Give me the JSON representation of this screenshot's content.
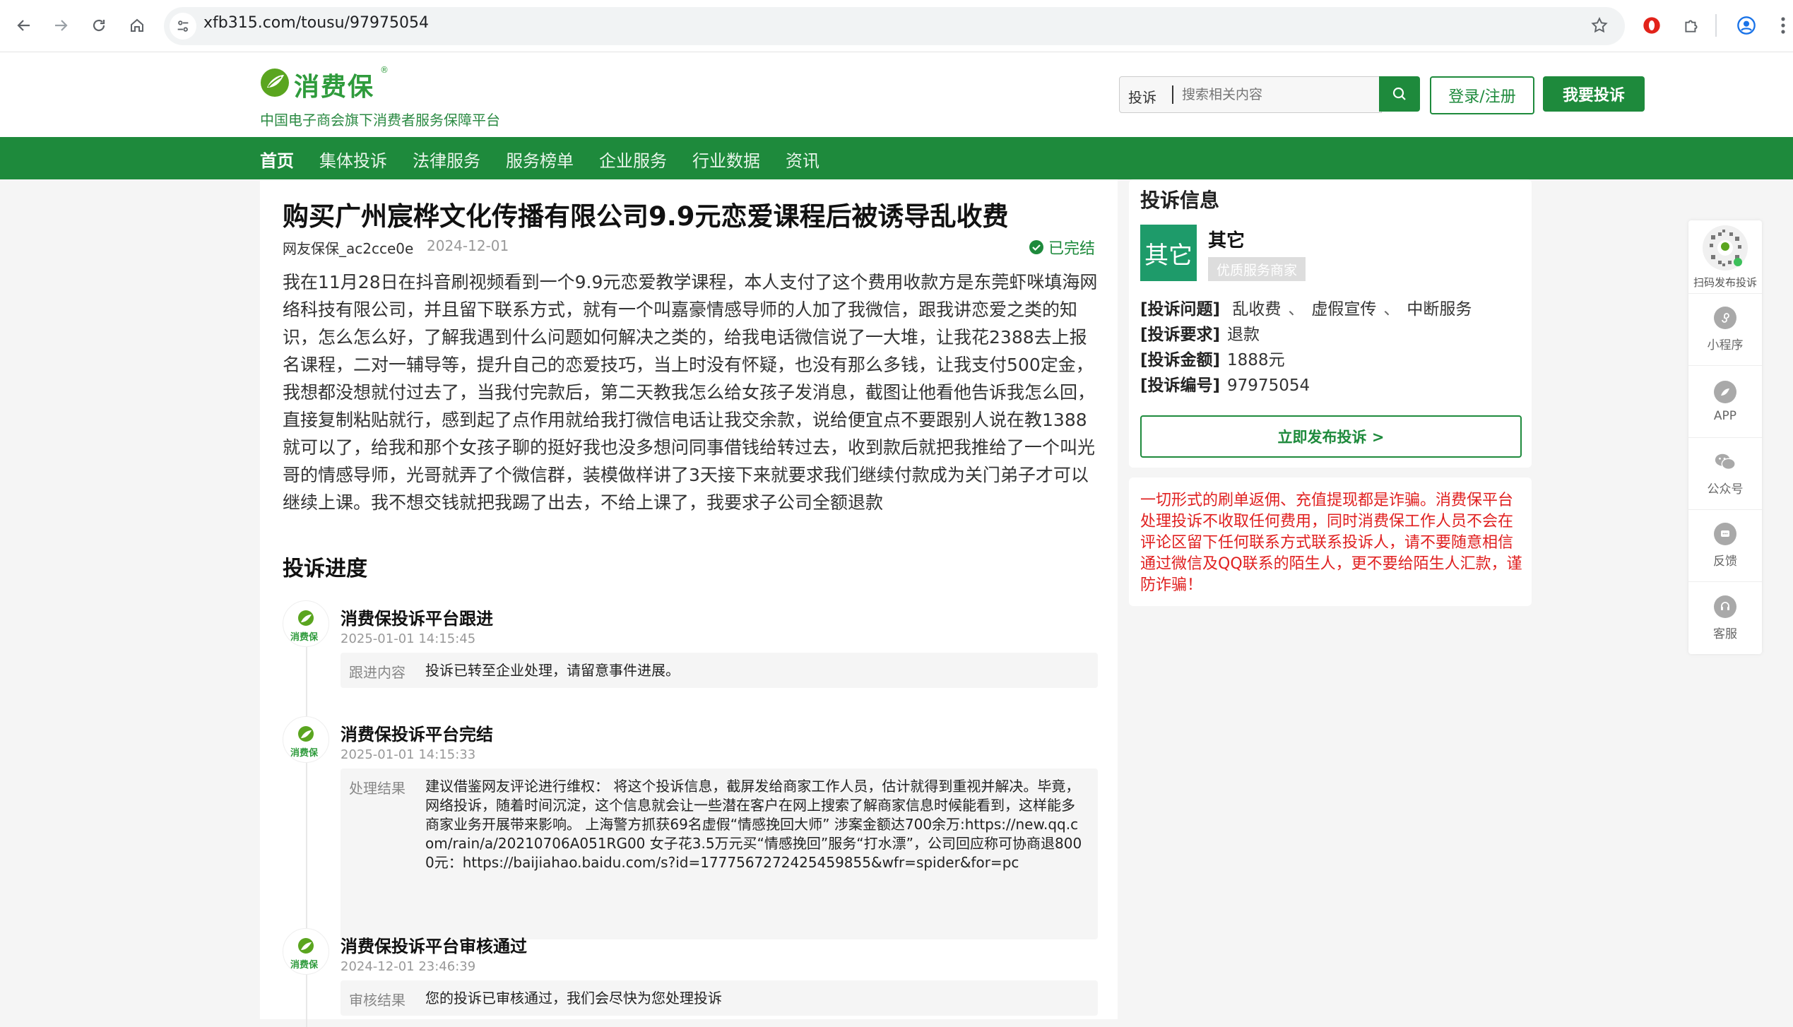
{
  "browser": {
    "url": "xfb315.com/tousu/97975054"
  },
  "header": {
    "logo_text": "消费保",
    "logo_reg": "®",
    "tagline": "中国电子商会旗下消费者服务保障平台",
    "search_category": "投诉",
    "search_placeholder": "搜索相关内容",
    "login_label": "登录/注册",
    "complain_label": "我要投诉"
  },
  "nav": {
    "items": [
      "首页",
      "集体投诉",
      "法律服务",
      "服务榜单",
      "企业服务",
      "行业数据",
      "资讯"
    ],
    "active": "首页"
  },
  "complaint": {
    "title": "购买广州宸桦文化传播有限公司9.9元恋爱课程后被诱导乱收费",
    "author": "网友保保_ac2cce0e",
    "date": "2024-12-01",
    "status": "已完结",
    "content": "我在11月28日在抖音刷视频看到一个9.9元恋爱教学课程，本人支付了这个费用收款方是东莞虾咪填海网络科技有限公司，并且留下联系方式，就有一个叫嘉豪情感导师的人加了我微信，跟我讲恋爱之类的知识，怎么怎么好，了解我遇到什么问题如何解决之类的，给我电话微信说了一大堆，让我花2388去上报名课程，二对一辅导等，提升自己的恋爱技巧，当上时没有怀疑，也没有那么多钱，让我支付500定金，我想都没想就付过去了，当我付完款后，第二天教我怎么给女孩子发消息，截图让他看他告诉我怎么回，直接复制粘贴就行，感到起了点作用就给我打微信电话让我交余款，说给便宜点不要跟别人说在教1388就可以了，给我和那个女孩子聊的挺好我也没多想问同事借钱给转过去，收到款后就把我推给了一个叫光哥的情感导师，光哥就弄了个微信群，装模做样讲了3天接下来就要求我们继续付款成为关门弟子才可以继续上课。我不想交钱就把我踢了出去，不给上课了，我要求子公司全额退款"
  },
  "progress": {
    "heading": "投诉进度",
    "avatar_text": "消费保",
    "items": [
      {
        "title": "消费保投诉平台跟进",
        "time": "2025-01-01 14:15:45",
        "label": "跟进内容",
        "text": "投诉已转至企业处理，请留意事件进展。"
      },
      {
        "title": "消费保投诉平台完结",
        "time": "2025-01-01 14:15:33",
        "label": "处理结果",
        "text": "建议借鉴网友评论进行维权： 将这个投诉信息，截屏发给商家工作人员，估计就得到重视并解决。毕竟，网络投诉，随着时间沉淀，这个信息就会让一些潜在客户在网上搜索了解商家信息时候能看到，这样能多商家业务开展带来影响。 上海警方抓获69名虚假“情感挽回大师” 涉案金额达700余万:https://new.qq.com/rain/a/20210706A051RG00 女子花3.5万元买“情感挽回”服务“打水漂”，公司回应称可协商退8000元：https://baijiahao.baidu.com/s?id=1777567272425459855&wfr=spider&for=pc"
      },
      {
        "title": "消费保投诉平台审核通过",
        "time": "2024-12-01 23:46:39",
        "label": "审核结果",
        "text": "您的投诉已审核通过，我们会尽快为您处理投诉"
      }
    ]
  },
  "info": {
    "heading": "投诉信息",
    "merchant_logo_text": "其它",
    "merchant_name": "其它",
    "merchant_badge": "优质服务商家",
    "issue_key": "[投诉问题]",
    "issue_tags": [
      "乱收费",
      "虚假宣传",
      "中断服务"
    ],
    "request_key": "[投诉要求]",
    "request_val": "退款",
    "amount_key": "[投诉金额]",
    "amount_val": "1888元",
    "number_key": "[投诉编号]",
    "number_val": "97975054",
    "publish_label": "立即发布投诉 >"
  },
  "warning": {
    "text": "一切形式的刷单返佣、充值提现都是诈骗。消费保平台处理投诉不收取任何费用，同时消费保工作人员不会在评论区留下任何联系方式联系投诉人，请不要随意相信通过微信及QQ联系的陌生人，更不要给陌生人汇款，谨防诈骗！"
  },
  "sidebar": {
    "qr_label": "扫码发布投诉",
    "items": [
      {
        "label": "小程序",
        "icon": "mini-program-icon"
      },
      {
        "label": "APP",
        "icon": "app-icon"
      },
      {
        "label": "公众号",
        "icon": "wechat-icon"
      },
      {
        "label": "反馈",
        "icon": "feedback-icon"
      },
      {
        "label": "客服",
        "icon": "customer-service-icon"
      }
    ]
  },
  "colors": {
    "brand_green": "#1e8a3c",
    "warning_red": "#e02020",
    "merchant_teal": "#1e9b6a"
  }
}
